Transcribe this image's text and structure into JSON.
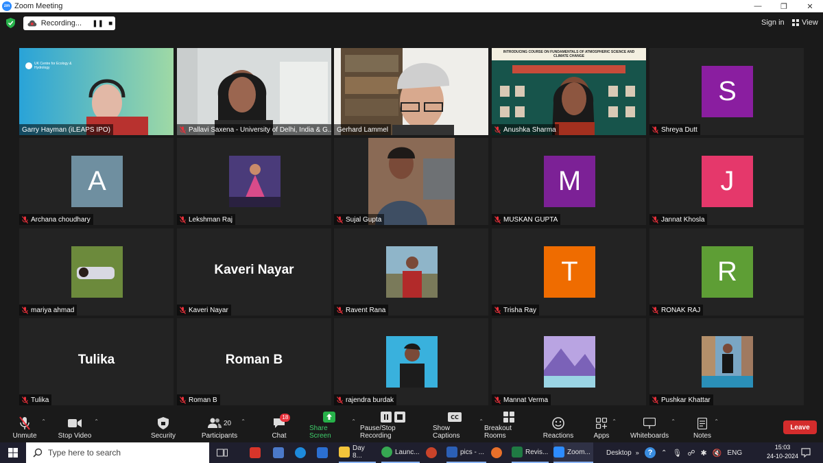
{
  "window": {
    "title": "Zoom Meeting",
    "app_icon": "zm"
  },
  "topbar": {
    "recording_label": "Recording...",
    "pause_glyph": "❚❚",
    "stop_glyph": "■",
    "sign_in": "Sign in",
    "view": "View"
  },
  "participants": [
    {
      "name": "Garry Hayman (iLEAPS IPO)",
      "type": "video",
      "muted": false,
      "banner": "UK Centre for Ecology & Hydrology"
    },
    {
      "name": "Pallavi Saxena - University of Delhi, India & G...",
      "type": "video",
      "muted": true
    },
    {
      "name": "Gerhard Lammel",
      "type": "video",
      "muted": false,
      "active": true
    },
    {
      "name": "Anushka Sharma",
      "type": "video",
      "muted": true,
      "poster_title": "INTRODUCING COURSE ON FUNDAMENTALS OF ATMOSPHERIC SCIENCE AND CLIMATE CHANGE"
    },
    {
      "name": "Shreya Dutt",
      "type": "avatar",
      "initial": "S",
      "color": "#8a1ea0",
      "muted": true
    },
    {
      "name": "Archana choudhary",
      "type": "avatar",
      "initial": "A",
      "color": "#6f8fa0",
      "muted": true
    },
    {
      "name": "Lekshman Raj",
      "type": "thumb",
      "muted": true
    },
    {
      "name": "Sujal Gupta",
      "type": "video",
      "muted": true
    },
    {
      "name": "MUSKAN GUPTA",
      "type": "avatar",
      "initial": "M",
      "color": "#7c2196",
      "muted": true
    },
    {
      "name": "Jannat Khosla",
      "type": "avatar",
      "initial": "J",
      "color": "#e5386b",
      "muted": true
    },
    {
      "name": "mariya ahmad",
      "type": "thumb",
      "muted": true
    },
    {
      "name": "Kaveri Nayar",
      "type": "text",
      "display": "Kaveri Nayar",
      "muted": true
    },
    {
      "name": "Ravent Rana",
      "type": "thumb",
      "muted": true
    },
    {
      "name": "Trisha Ray",
      "type": "avatar",
      "initial": "T",
      "color": "#ef6c00",
      "muted": true
    },
    {
      "name": "RONAK RAJ",
      "type": "avatar",
      "initial": "R",
      "color": "#5e9e35",
      "muted": true
    },
    {
      "name": "Tulika",
      "type": "text",
      "display": "Tulika",
      "muted": true
    },
    {
      "name": "Roman B",
      "type": "text",
      "display": "Roman B",
      "muted": true
    },
    {
      "name": "rajendra burdak",
      "type": "thumb",
      "muted": true
    },
    {
      "name": "Mannat Verma",
      "type": "thumb",
      "muted": true
    },
    {
      "name": "Pushkar Khattar",
      "type": "thumb",
      "muted": true
    }
  ],
  "toolbar": {
    "unmute": "Unmute",
    "stop_video": "Stop Video",
    "security": "Security",
    "participants": "Participants",
    "participants_count": "20",
    "chat": "Chat",
    "chat_badge": "18",
    "share_screen": "Share Screen",
    "pause_stop_recording": "Pause/Stop Recording",
    "show_captions": "Show Captions",
    "breakout_rooms": "Breakout Rooms",
    "reactions": "Reactions",
    "apps": "Apps",
    "whiteboards": "Whiteboards",
    "notes": "Notes",
    "leave": "Leave"
  },
  "taskbar": {
    "search_placeholder": "Type here to search",
    "apps": [
      {
        "label": "Day 8..."
      },
      {
        "label": "Launc..."
      },
      {
        "label": "pics - ..."
      },
      {
        "label": "Revis..."
      },
      {
        "label": "Zoom..."
      }
    ],
    "desktop": "Desktop",
    "language": "ENG",
    "time": "15:03",
    "date": "24-10-2024"
  },
  "colors": {
    "background": "#1a1a1a",
    "tile": "#232323",
    "active_speaker": "#d9e96a",
    "leave": "#d42c2c",
    "share": "#3fcf6b",
    "muted_mic": "#e8303a"
  }
}
